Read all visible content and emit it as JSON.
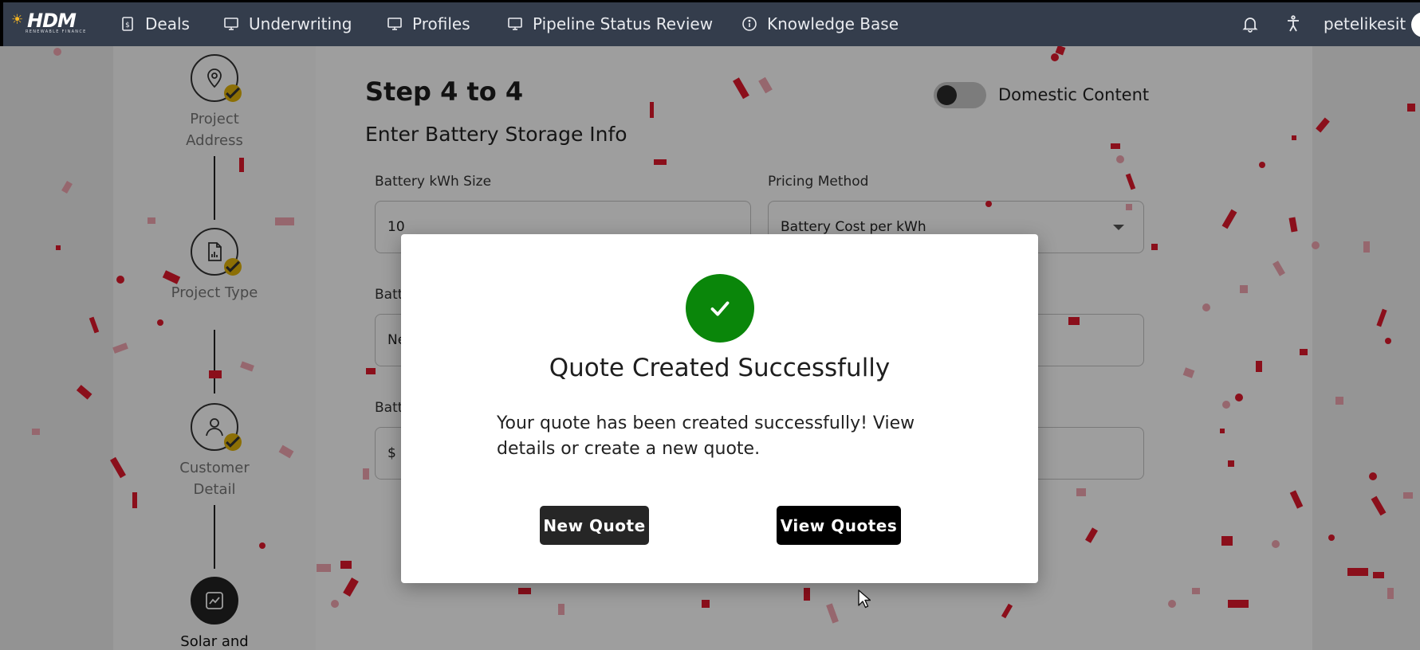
{
  "nav": {
    "logo_text": "HDM",
    "logo_subtext": "RENEWABLE FINANCE",
    "items": [
      {
        "label": "Deals",
        "icon": "dollar-doc-icon"
      },
      {
        "label": "Underwriting",
        "icon": "monitor-icon"
      },
      {
        "label": "Profiles",
        "icon": "monitor-icon"
      },
      {
        "label": "Pipeline Status Review",
        "icon": "monitor-icon"
      },
      {
        "label": "Knowledge Base",
        "icon": "info-icon"
      }
    ],
    "username": "petelikesit"
  },
  "stepper": {
    "steps": [
      {
        "label_line1": "Project",
        "label_line2": "Address",
        "completed": true
      },
      {
        "label_line1": "Project Type",
        "label_line2": "",
        "completed": true
      },
      {
        "label_line1": "Customer",
        "label_line2": "Detail",
        "completed": true
      },
      {
        "label_line1": "Solar and",
        "label_line2": "",
        "completed": false,
        "active": true
      }
    ]
  },
  "form": {
    "heading": "Step 4 to 4",
    "subheading": "Enter Battery Storage Info",
    "toggle_label": "Domestic Content",
    "toggle_on": false,
    "fields": {
      "battery_kwh_label": "Battery kWh Size",
      "battery_kwh_value": "10",
      "pricing_method_label": "Pricing Method",
      "pricing_method_value": "Battery Cost per kWh",
      "row2_label_partial": "Batt",
      "row2_value_partial": "Ne",
      "row3_label_partial": "Batt",
      "row3_value_partial": "$"
    }
  },
  "modal": {
    "title": "Quote Created Successfully",
    "message": "Your quote has been created successfully! View details or create a new quote.",
    "new_quote_label": "New Quote",
    "view_quotes_label": "View Quotes",
    "success_color": "#0a860a"
  },
  "colors": {
    "nav_bg": "#343d4c",
    "check_badge": "#e2b409",
    "confetti_red": "#e0192c",
    "confetti_pink": "#f3a6b2"
  }
}
